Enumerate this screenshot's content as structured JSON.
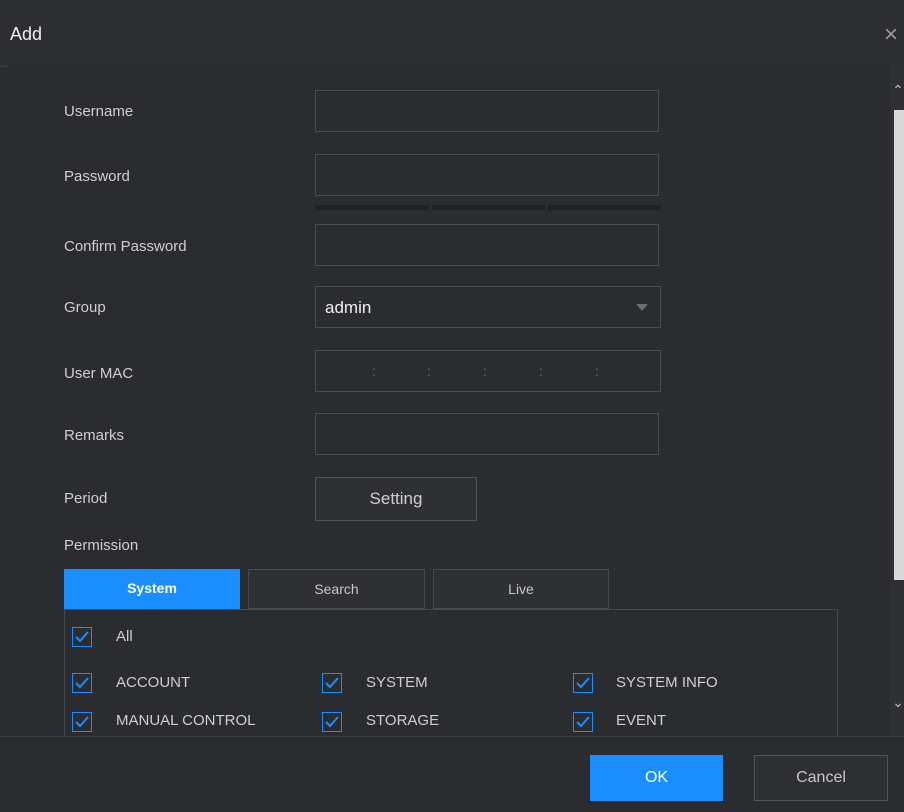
{
  "dialog": {
    "title": "Add",
    "close_glyph": "×"
  },
  "form": {
    "username_label": "Username",
    "username_value": "",
    "password_label": "Password",
    "password_value": "",
    "confirm_password_label": "Confirm Password",
    "confirm_password_value": "",
    "group_label": "Group",
    "group_value": "admin",
    "user_mac_label": "User MAC",
    "mac_separator": ":",
    "remarks_label": "Remarks",
    "remarks_value": "",
    "period_label": "Period",
    "setting_button": "Setting",
    "permission_label": "Permission"
  },
  "tabs": [
    {
      "label": "System",
      "active": true
    },
    {
      "label": "Search",
      "active": false
    },
    {
      "label": "Live",
      "active": false
    }
  ],
  "permissions": {
    "all": {
      "label": "All",
      "checked": true
    },
    "items": [
      {
        "label": "ACCOUNT",
        "checked": true
      },
      {
        "label": "SYSTEM",
        "checked": true
      },
      {
        "label": "SYSTEM INFO",
        "checked": true
      },
      {
        "label": "MANUAL CONTROL",
        "checked": true
      },
      {
        "label": "STORAGE",
        "checked": true
      },
      {
        "label": "EVENT",
        "checked": true
      }
    ]
  },
  "footer": {
    "ok_label": "OK",
    "cancel_label": "Cancel"
  },
  "colors": {
    "accent": "#1a8eff",
    "background": "#2a2c30"
  }
}
